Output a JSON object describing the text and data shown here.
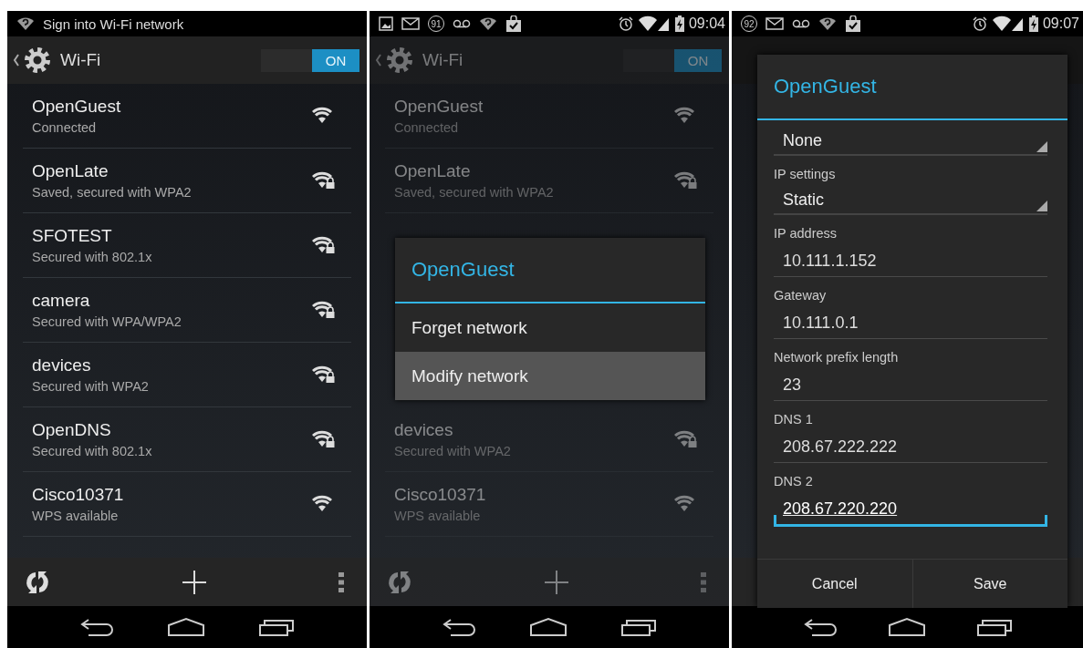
{
  "panels": [
    {
      "dimmed": false,
      "status_bar": {
        "notification": "Sign into Wi-Fi network"
      },
      "action_bar": {
        "title": "Wi-Fi",
        "toggle": {
          "label": "ON",
          "on": true
        }
      },
      "networks": [
        {
          "name": "OpenGuest",
          "status": "Connected",
          "secured": false
        },
        {
          "name": "OpenLate",
          "status": "Saved, secured with WPA2",
          "secured": true
        },
        {
          "name": "SFOTEST",
          "status": "Secured with 802.1x",
          "secured": true
        },
        {
          "name": "camera",
          "status": "Secured with WPA/WPA2",
          "secured": true
        },
        {
          "name": "devices",
          "status": "Secured with WPA2",
          "secured": true
        },
        {
          "name": "OpenDNS",
          "status": "Secured with 802.1x",
          "secured": true
        },
        {
          "name": "Cisco10371",
          "status": "WPS available",
          "secured": false
        }
      ]
    },
    {
      "dimmed": true,
      "status_bar": {
        "badge": "91",
        "time": "09:04"
      },
      "action_bar": {
        "title": "Wi-Fi",
        "toggle": {
          "label": "ON",
          "on": true
        }
      },
      "networks": [
        {
          "name": "OpenGuest",
          "status": "Connected",
          "secured": false
        },
        {
          "name": "OpenLate",
          "status": "Saved, secured with WPA2",
          "secured": true
        }
      ],
      "context_menu": {
        "title": "OpenGuest",
        "items": [
          {
            "label": "Forget network",
            "selected": false
          },
          {
            "label": "Modify network",
            "selected": true
          }
        ]
      },
      "networks_below": [
        {
          "name": "devices",
          "status": "Secured with WPA2",
          "secured": true
        },
        {
          "name": "Cisco10371",
          "status": "WPS available",
          "secured": false
        }
      ]
    },
    {
      "dimmed": true,
      "status_bar": {
        "badge": "92",
        "time": "09:07"
      },
      "dialog": {
        "title": "OpenGuest",
        "fields": [
          {
            "kind": "dropdown",
            "value": "None"
          },
          {
            "kind": "dropdown",
            "label": "IP settings",
            "value": "Static"
          },
          {
            "kind": "text",
            "label": "IP address",
            "value": "10.111.1.152",
            "focused": false
          },
          {
            "kind": "text",
            "label": "Gateway",
            "value": "10.111.0.1",
            "focused": false
          },
          {
            "kind": "text",
            "label": "Network prefix length",
            "value": "23",
            "focused": false
          },
          {
            "kind": "text",
            "label": "DNS 1",
            "value": "208.67.222.222",
            "focused": false
          },
          {
            "kind": "text",
            "label": "DNS 2",
            "value": "208.67.220.220",
            "focused": true
          }
        ],
        "buttons": [
          "Cancel",
          "Save"
        ]
      }
    }
  ]
}
